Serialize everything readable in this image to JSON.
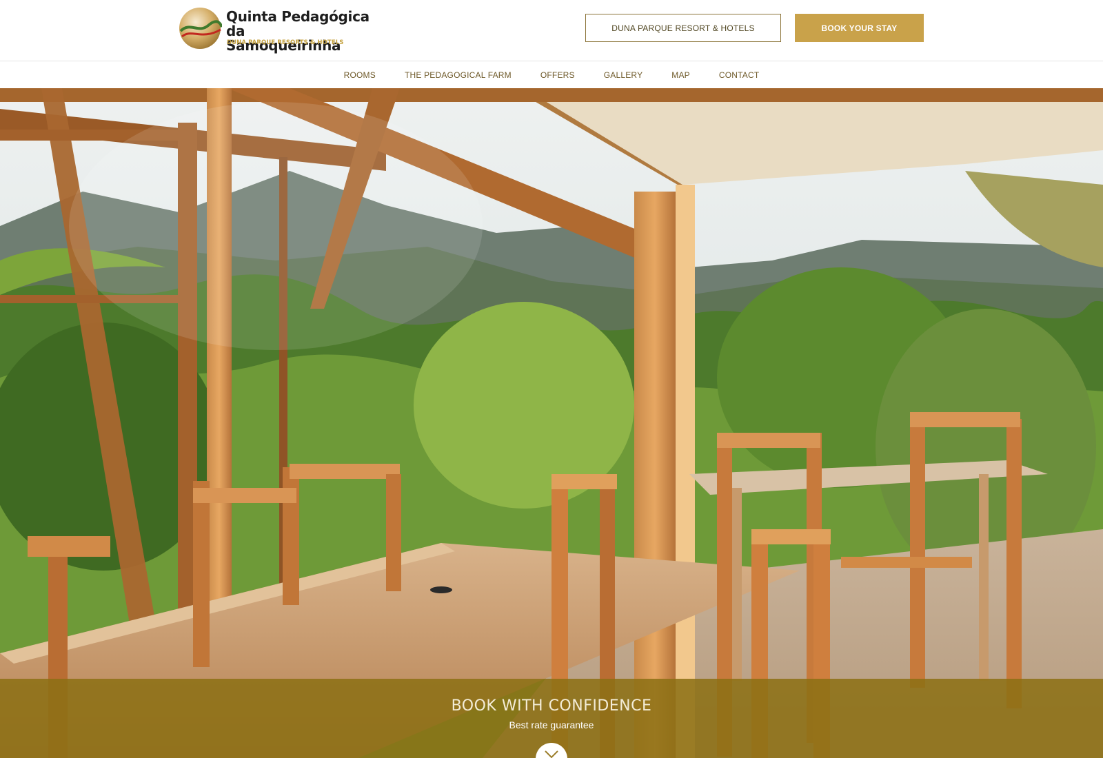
{
  "header": {
    "logo": {
      "title_line1": "Quinta Pedagógica da",
      "title_line2": "Samoqueirinha",
      "subtitle": "DUNA PARQUE RESORTS & HOTELS"
    },
    "group_button_label": "DUNA PARQUE RESORT & HOTELS",
    "book_button_label": "BOOK YOUR STAY"
  },
  "nav": {
    "items": [
      {
        "label": "ROOMS"
      },
      {
        "label": "THE PEDAGOGICAL FARM"
      },
      {
        "label": "OFFERS"
      },
      {
        "label": "GALLERY"
      },
      {
        "label": "MAP"
      },
      {
        "label": "CONTACT"
      }
    ]
  },
  "hero": {
    "image_icon": "terrace-photo",
    "band_title": "BOOK WITH CONFIDENCE",
    "band_subtitle": "Best rate guarantee",
    "scroll_icon": "chevron-down-icon"
  },
  "colors": {
    "accent_gold": "#c9a24a",
    "band_gold": "#8c7014",
    "nav_text": "#6f5a2a"
  }
}
